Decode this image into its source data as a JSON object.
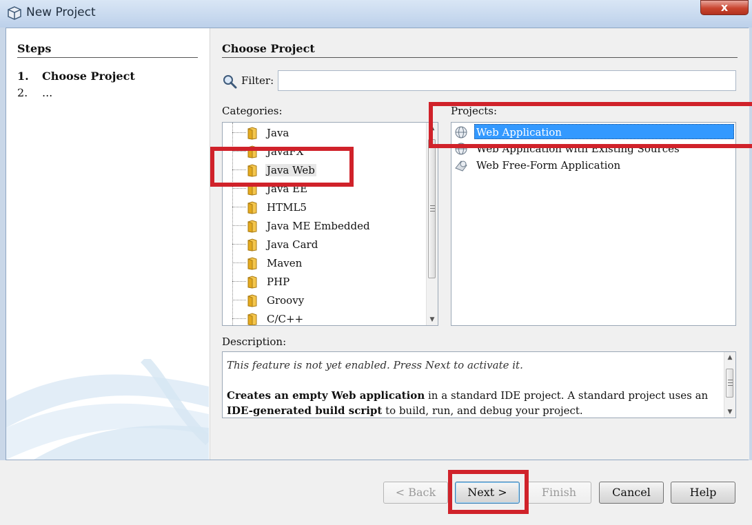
{
  "window": {
    "title": "New Project",
    "close_label": "x"
  },
  "steps": {
    "title": "Steps",
    "items": [
      {
        "num": "1.",
        "label": "Choose Project"
      },
      {
        "num": "2.",
        "label": "..."
      }
    ]
  },
  "main": {
    "title": "Choose Project",
    "filter": {
      "label": "Filter:",
      "value": ""
    },
    "categories_label": "Categories:",
    "projects_label": "Projects:",
    "categories": [
      "Java",
      "JavaFX",
      "Java Web",
      "Java EE",
      "HTML5",
      "Java ME Embedded",
      "Java Card",
      "Maven",
      "PHP",
      "Groovy",
      "C/C++"
    ],
    "selected_category": "Java Web",
    "projects": [
      "Web Application",
      "Web Application with Existing Sources",
      "Web Free-Form Application"
    ],
    "selected_project": "Web Application",
    "description_label": "Description:",
    "description": {
      "notice": "This feature is not yet enabled. Press Next to activate it.",
      "b1": "Creates an empty Web application",
      "t1": " in a standard IDE project. A standard project uses an",
      "b2": "IDE-generated build script",
      "t2": " to build, run, and debug your project."
    }
  },
  "buttons": {
    "back": "< Back",
    "next": "Next >",
    "finish": "Finish",
    "cancel": "Cancel",
    "help": "Help"
  },
  "colors": {
    "highlight": "#3399ff",
    "annotation": "#d0222a"
  }
}
